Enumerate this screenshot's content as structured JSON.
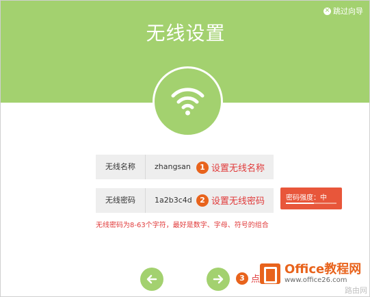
{
  "header": {
    "title": "无线设置",
    "skip_label": "跳过向导",
    "accent_color": "#a3d16f"
  },
  "form": {
    "ssid": {
      "label": "无线名称",
      "value": "zhangsan"
    },
    "password": {
      "label": "无线密码",
      "value": "1a2b3c4d"
    },
    "hint": "无线密码为8-63个字符，最好是数字、字母、符号的组合"
  },
  "steps": [
    {
      "num": "1",
      "text": "设置无线名称"
    },
    {
      "num": "2",
      "text": "设置无线密码"
    },
    {
      "num": "3",
      "text": "点"
    }
  ],
  "strength": {
    "label": "密码强度：中",
    "level_fraction": 0.55
  },
  "nav": {
    "prev_icon": "arrow-left-icon",
    "next_icon": "arrow-right-icon"
  },
  "watermark": {
    "title": "Office教程网",
    "url": "www.office26.com",
    "corner": "路由网"
  }
}
